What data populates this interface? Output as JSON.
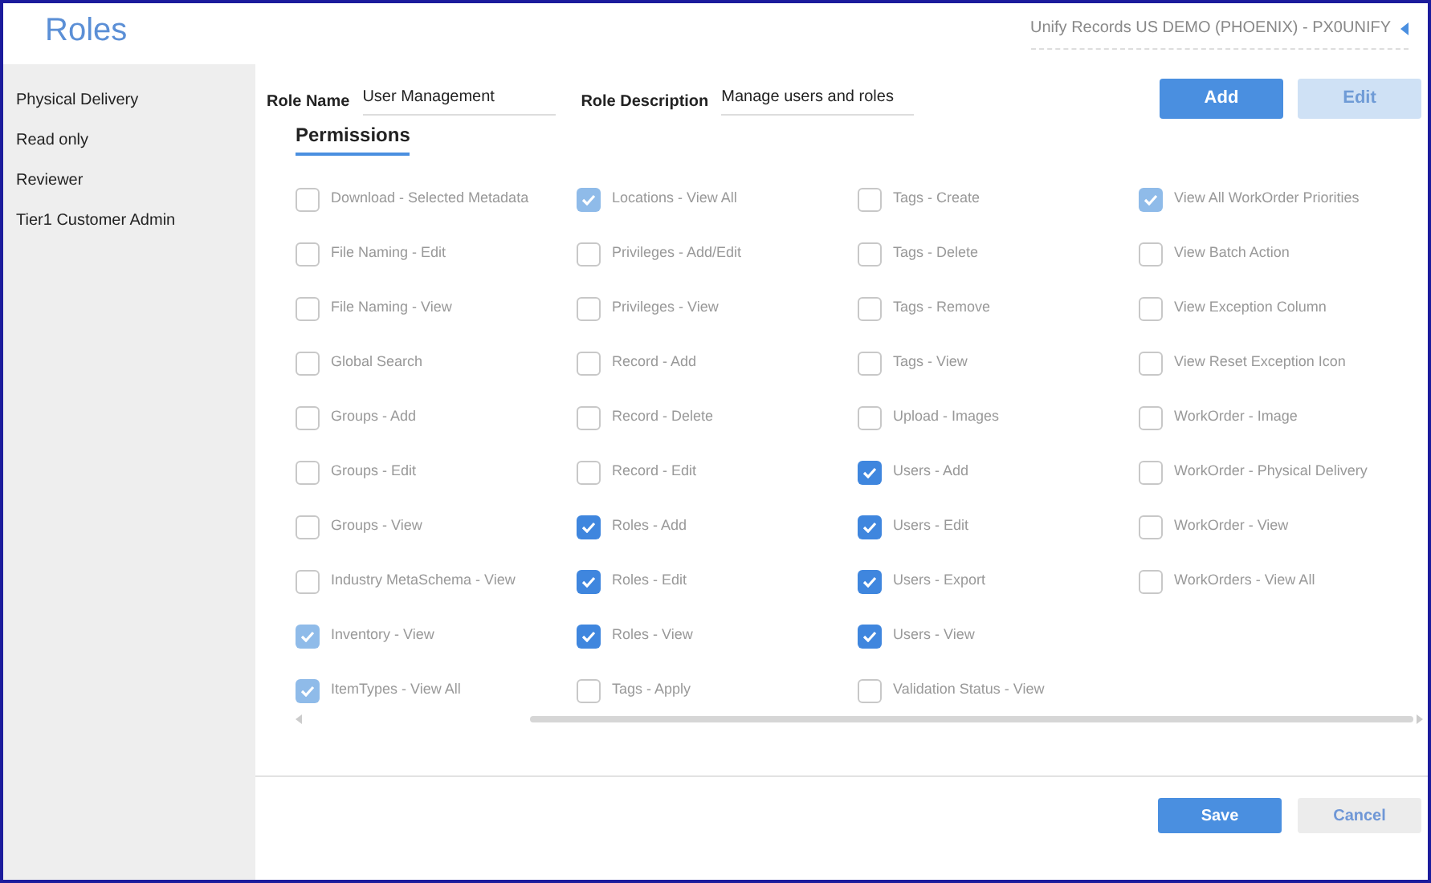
{
  "page_title": "Roles",
  "tenant": {
    "label": "Unify Records US DEMO (PHOENIX) - PX0UNIFY"
  },
  "sidebar": {
    "items": [
      {
        "label": "Physical Delivery",
        "selected": false
      },
      {
        "label": "Read only",
        "selected": false
      },
      {
        "label": "Reviewer",
        "selected": false
      },
      {
        "label": "Tier1 Customer Admin",
        "selected": false
      }
    ]
  },
  "role_name": {
    "label": "Role Name",
    "value": "User Management"
  },
  "role_description": {
    "label": "Role Description",
    "value": "Manage users and roles"
  },
  "top_buttons": [
    {
      "label": "Add",
      "disabled": false
    },
    {
      "label": "Edit",
      "disabled": true
    }
  ],
  "permissions_heading": "Permissions",
  "permission_columns": [
    [
      {
        "label": "Download - Selected Metadata",
        "checked": false,
        "disabled": false
      },
      {
        "label": "File Naming - Edit",
        "checked": false,
        "disabled": false
      },
      {
        "label": "File Naming - View",
        "checked": false,
        "disabled": false
      },
      {
        "label": "Global Search",
        "checked": false,
        "disabled": false
      },
      {
        "label": "Groups - Add",
        "checked": false,
        "disabled": false
      },
      {
        "label": "Groups - Edit",
        "checked": false,
        "disabled": false
      },
      {
        "label": "Groups - View",
        "checked": false,
        "disabled": false
      },
      {
        "label": "Industry MetaSchema - View",
        "checked": false,
        "disabled": false
      },
      {
        "label": "Inventory - View",
        "checked": true,
        "disabled": true
      },
      {
        "label": "ItemTypes - View All",
        "checked": true,
        "disabled": true
      }
    ],
    [
      {
        "label": "Locations - View All",
        "checked": true,
        "disabled": true
      },
      {
        "label": "Privileges - Add/Edit",
        "checked": false,
        "disabled": false
      },
      {
        "label": "Privileges - View",
        "checked": false,
        "disabled": false
      },
      {
        "label": "Record - Add",
        "checked": false,
        "disabled": false
      },
      {
        "label": "Record - Delete",
        "checked": false,
        "disabled": false
      },
      {
        "label": "Record - Edit",
        "checked": false,
        "disabled": false
      },
      {
        "label": "Roles - Add",
        "checked": true,
        "disabled": false
      },
      {
        "label": "Roles - Edit",
        "checked": true,
        "disabled": false
      },
      {
        "label": "Roles - View",
        "checked": true,
        "disabled": false
      },
      {
        "label": "Tags - Apply",
        "checked": false,
        "disabled": false
      }
    ],
    [
      {
        "label": "Tags - Create",
        "checked": false,
        "disabled": false
      },
      {
        "label": "Tags - Delete",
        "checked": false,
        "disabled": false
      },
      {
        "label": "Tags - Remove",
        "checked": false,
        "disabled": false
      },
      {
        "label": "Tags - View",
        "checked": false,
        "disabled": false
      },
      {
        "label": "Upload - Images",
        "checked": false,
        "disabled": false
      },
      {
        "label": "Users - Add",
        "checked": true,
        "disabled": false
      },
      {
        "label": "Users - Edit",
        "checked": true,
        "disabled": false
      },
      {
        "label": "Users - Export",
        "checked": true,
        "disabled": false
      },
      {
        "label": "Users - View",
        "checked": true,
        "disabled": false
      },
      {
        "label": "Validation Status - View",
        "checked": false,
        "disabled": false
      }
    ],
    [
      {
        "label": "View All WorkOrder Priorities",
        "checked": true,
        "disabled": true
      },
      {
        "label": "View Batch Action",
        "checked": false,
        "disabled": false
      },
      {
        "label": "View Exception Column",
        "checked": false,
        "disabled": false
      },
      {
        "label": "View Reset Exception Icon",
        "checked": false,
        "disabled": false
      },
      {
        "label": "WorkOrder - Image",
        "checked": false,
        "disabled": false
      },
      {
        "label": "WorkOrder - Physical Delivery",
        "checked": false,
        "disabled": false
      },
      {
        "label": "WorkOrder - View",
        "checked": false,
        "disabled": false
      },
      {
        "label": "WorkOrders - View All",
        "checked": false,
        "disabled": false
      }
    ]
  ],
  "bottom_buttons": [
    {
      "label": "Save",
      "kind": "primary"
    },
    {
      "label": "Cancel",
      "kind": "secondary"
    }
  ]
}
